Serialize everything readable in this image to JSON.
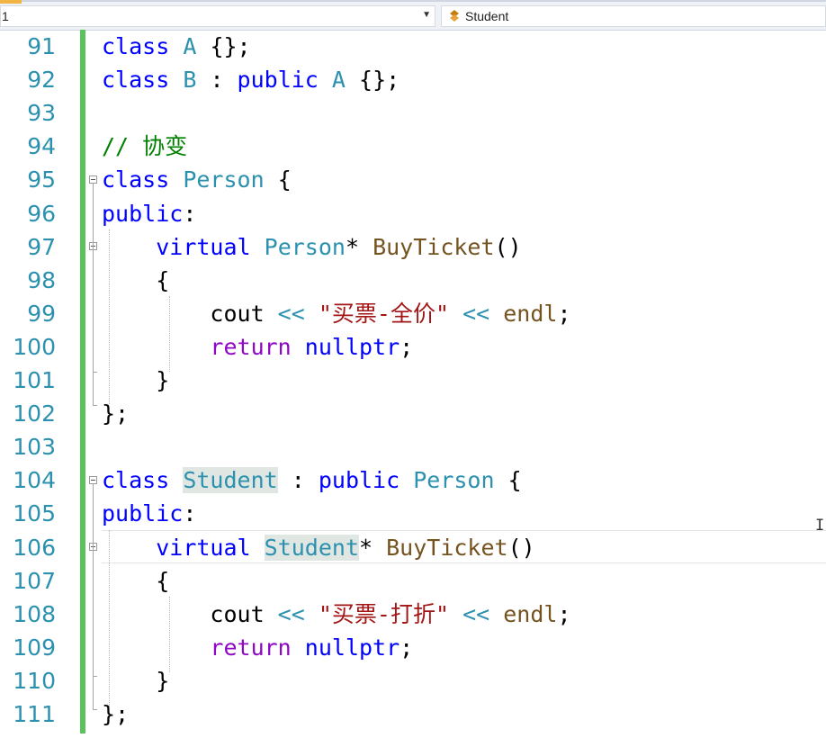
{
  "nav": {
    "left_label": "1",
    "right_label": "Student"
  },
  "lines": [
    {
      "n": "91",
      "tokens": [
        {
          "t": "class",
          "c": "kw"
        },
        {
          "t": " "
        },
        {
          "t": "A",
          "c": "type"
        },
        {
          "t": " {};"
        }
      ]
    },
    {
      "n": "92",
      "tokens": [
        {
          "t": "class",
          "c": "kw"
        },
        {
          "t": " "
        },
        {
          "t": "B",
          "c": "type"
        },
        {
          "t": " : "
        },
        {
          "t": "public",
          "c": "kw"
        },
        {
          "t": " "
        },
        {
          "t": "A",
          "c": "type"
        },
        {
          "t": " {};"
        }
      ]
    },
    {
      "n": "93",
      "tokens": []
    },
    {
      "n": "94",
      "tokens": [
        {
          "t": "// 协变",
          "c": "cmt"
        }
      ]
    },
    {
      "n": "95",
      "tokens": [
        {
          "t": "class",
          "c": "kw"
        },
        {
          "t": " "
        },
        {
          "t": "Person",
          "c": "type"
        },
        {
          "t": " {"
        }
      ]
    },
    {
      "n": "96",
      "tokens": [
        {
          "t": "public",
          "c": "kw"
        },
        {
          "t": ":"
        }
      ]
    },
    {
      "n": "97",
      "tokens": [
        {
          "t": "    "
        },
        {
          "t": "virtual",
          "c": "kw"
        },
        {
          "t": " "
        },
        {
          "t": "Person",
          "c": "type"
        },
        {
          "t": "* "
        },
        {
          "t": "BuyTicket",
          "c": "fn"
        },
        {
          "t": "()"
        }
      ]
    },
    {
      "n": "98",
      "tokens": [
        {
          "t": "    {"
        }
      ]
    },
    {
      "n": "99",
      "tokens": [
        {
          "t": "        cout "
        },
        {
          "t": "<<",
          "c": "type"
        },
        {
          "t": " "
        },
        {
          "t": "\"买票-全价\"",
          "c": "str"
        },
        {
          "t": " "
        },
        {
          "t": "<<",
          "c": "type"
        },
        {
          "t": " "
        },
        {
          "t": "endl",
          "c": "fn"
        },
        {
          "t": ";"
        }
      ]
    },
    {
      "n": "100",
      "tokens": [
        {
          "t": "        "
        },
        {
          "t": "return",
          "c": "ctl"
        },
        {
          "t": " "
        },
        {
          "t": "nullptr",
          "c": "kw"
        },
        {
          "t": ";"
        }
      ]
    },
    {
      "n": "101",
      "tokens": [
        {
          "t": "    }"
        }
      ]
    },
    {
      "n": "102",
      "tokens": [
        {
          "t": "};"
        }
      ]
    },
    {
      "n": "103",
      "tokens": []
    },
    {
      "n": "104",
      "tokens": [
        {
          "t": "class",
          "c": "kw"
        },
        {
          "t": " "
        },
        {
          "t": "Student",
          "c": "type hl"
        },
        {
          "t": " : "
        },
        {
          "t": "public",
          "c": "kw"
        },
        {
          "t": " "
        },
        {
          "t": "Person",
          "c": "type"
        },
        {
          "t": " {"
        }
      ]
    },
    {
      "n": "105",
      "tokens": [
        {
          "t": "public",
          "c": "kw"
        },
        {
          "t": ":"
        }
      ]
    },
    {
      "n": "106",
      "tokens": [
        {
          "t": "    "
        },
        {
          "t": "virtual",
          "c": "kw"
        },
        {
          "t": " "
        },
        {
          "t": "Student",
          "c": "type hl"
        },
        {
          "t": "* "
        },
        {
          "t": "BuyTicket",
          "c": "fn"
        },
        {
          "t": "()"
        }
      ]
    },
    {
      "n": "107",
      "tokens": [
        {
          "t": "    {"
        }
      ]
    },
    {
      "n": "108",
      "tokens": [
        {
          "t": "        cout "
        },
        {
          "t": "<<",
          "c": "type"
        },
        {
          "t": " "
        },
        {
          "t": "\"买票-打折\"",
          "c": "str"
        },
        {
          "t": " "
        },
        {
          "t": "<<",
          "c": "type"
        },
        {
          "t": " "
        },
        {
          "t": "endl",
          "c": "fn"
        },
        {
          "t": ";"
        }
      ]
    },
    {
      "n": "109",
      "tokens": [
        {
          "t": "        "
        },
        {
          "t": "return",
          "c": "ctl"
        },
        {
          "t": " "
        },
        {
          "t": "nullptr",
          "c": "kw"
        },
        {
          "t": ";"
        }
      ]
    },
    {
      "n": "110",
      "tokens": [
        {
          "t": "    }"
        }
      ]
    },
    {
      "n": "111",
      "tokens": [
        {
          "t": "};"
        }
      ]
    }
  ],
  "colors": {
    "keyword": "#0000ff",
    "type": "#2b91af",
    "function": "#74531f",
    "string": "#a31515",
    "comment": "#008000",
    "control": "#8f08c4",
    "line_number": "#2b91af",
    "change_bar": "#5cc25c"
  }
}
